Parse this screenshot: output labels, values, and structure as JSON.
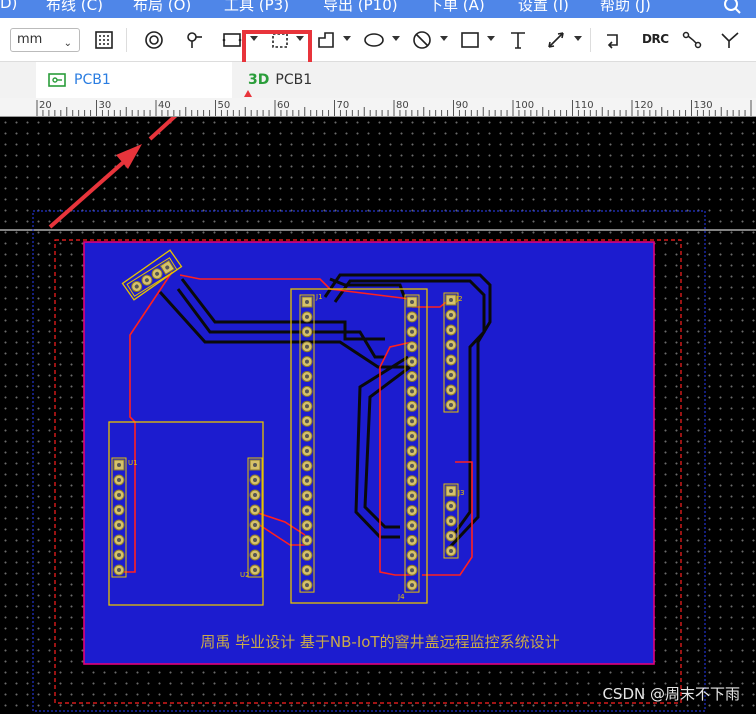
{
  "menu": {
    "items": [
      "D)",
      "布线 (C)",
      "布局 (O)",
      "工具 (P3)",
      "导出 (P10)",
      "下单 (A)",
      "设置 (I)",
      "帮助 (J)"
    ]
  },
  "toolbar": {
    "unit": "mm",
    "drc_label": "DRC"
  },
  "tabs": [
    {
      "label": "PCB1",
      "kind": "pcb"
    },
    {
      "label": "PCB1",
      "kind": "3d",
      "prefix": "3D"
    }
  ],
  "ruler": {
    "ticks": [
      "20",
      "30",
      "40",
      "50",
      "60",
      "70",
      "80",
      "90",
      "100",
      "110",
      "120",
      "130"
    ]
  },
  "board": {
    "silkscreen_text": "周禹 毕业设计 基于NB-IoT的窨井盖远程监控系统设计",
    "refs": [
      "U1",
      "U2",
      "J1",
      "J2",
      "J3",
      "J4"
    ]
  },
  "watermark": "CSDN @周末不下雨",
  "colors": {
    "menubar": "#4f86e8",
    "board_fill": "#1c1ccf",
    "outline": "#e0007a",
    "top_trace": "#ff2020",
    "silk": "#e6c300",
    "highlight": "#e8343b"
  }
}
